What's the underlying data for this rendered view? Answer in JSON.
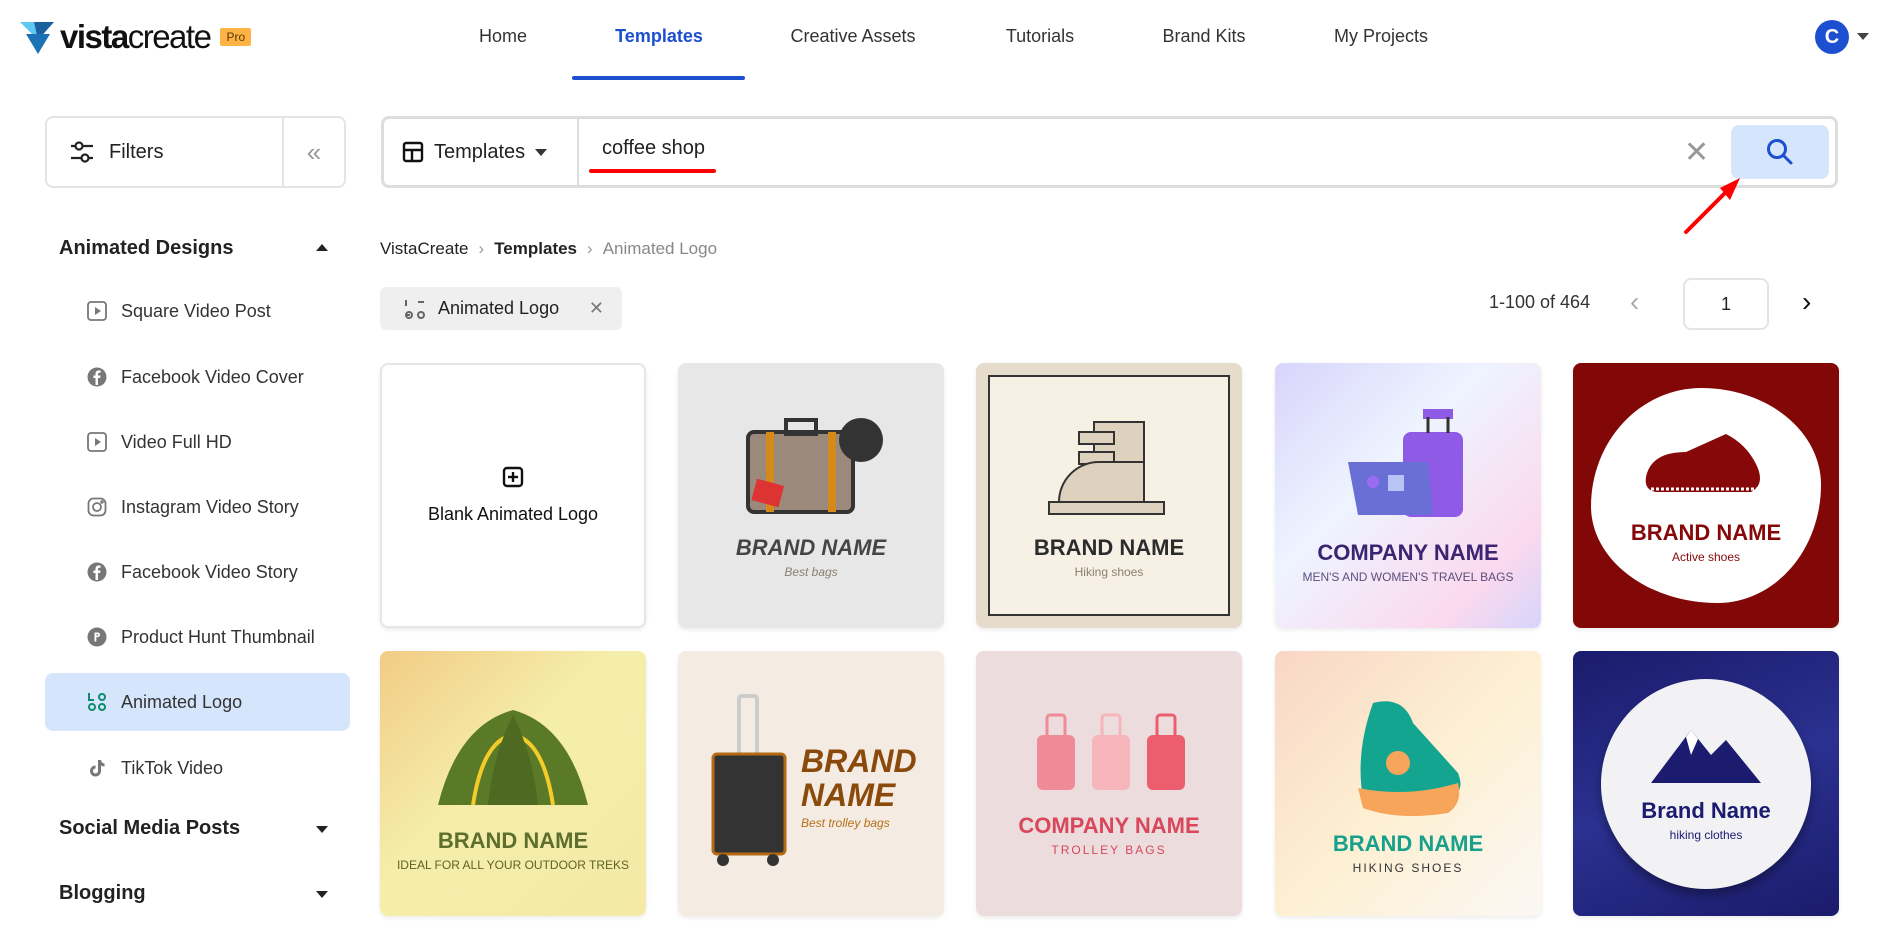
{
  "brand": {
    "name_bold": "vista",
    "name_light": "create",
    "badge": "Pro"
  },
  "nav": {
    "items": [
      {
        "label": "Home"
      },
      {
        "label": "Templates",
        "active": true
      },
      {
        "label": "Creative Assets"
      },
      {
        "label": "Tutorials"
      },
      {
        "label": "Brand Kits"
      },
      {
        "label": "My Projects"
      }
    ]
  },
  "user": {
    "avatar_initial": "C"
  },
  "filters": {
    "label": "Filters",
    "collapse_icon": "double-chevron-left-icon"
  },
  "search": {
    "type_label": "Templates",
    "value": "coffee shop",
    "clear_icon": "close-icon",
    "search_icon": "search-icon"
  },
  "breadcrumb": [
    "VistaCreate",
    "Templates",
    "Animated Logo"
  ],
  "active_filter": {
    "label": "Animated Logo"
  },
  "pagination": {
    "range": "1-100 of 464",
    "page": "1"
  },
  "sidebar": {
    "section": "Animated Designs",
    "items": [
      {
        "label": "Square Video Post",
        "icon": "play-icon"
      },
      {
        "label": "Facebook Video Cover",
        "icon": "facebook-icon"
      },
      {
        "label": "Video Full HD",
        "icon": "play-icon"
      },
      {
        "label": "Instagram Video Story",
        "icon": "instagram-icon"
      },
      {
        "label": "Facebook Video Story",
        "icon": "facebook-icon"
      },
      {
        "label": "Product Hunt Thumbnail",
        "icon": "product-hunt-icon"
      },
      {
        "label": "Animated Logo",
        "icon": "animated-logo-icon",
        "active": true
      },
      {
        "label": "TikTok Video",
        "icon": "tiktok-icon"
      }
    ],
    "collapsed_sections": [
      "Social Media Posts",
      "Blogging"
    ]
  },
  "colors": {
    "accent": "#1d4fd1",
    "accent_light": "#d5e6fc",
    "annotation": "#ff0000"
  },
  "templates": [
    {
      "title": "Blank Animated Logo",
      "blank": true
    },
    {
      "title": "BRAND NAME",
      "subtitle": "Best bags"
    },
    {
      "title": "BRAND NAME",
      "subtitle": "Hiking shoes"
    },
    {
      "title": "COMPANY NAME",
      "subtitle": "MEN'S AND WOMEN'S TRAVEL BAGS"
    },
    {
      "title": "BRAND NAME",
      "subtitle": "Active shoes"
    },
    {
      "title": "BRAND NAME",
      "subtitle": "IDEAL FOR ALL YOUR OUTDOOR TREKS"
    },
    {
      "title": "BRAND NAME",
      "subtitle": "Best trolley bags"
    },
    {
      "title": "COMPANY NAME",
      "subtitle": "TROLLEY BAGS"
    },
    {
      "title": "BRAND NAME",
      "subtitle": "HIKING SHOES"
    },
    {
      "title": "Brand Name",
      "subtitle": "hiking clothes"
    }
  ]
}
